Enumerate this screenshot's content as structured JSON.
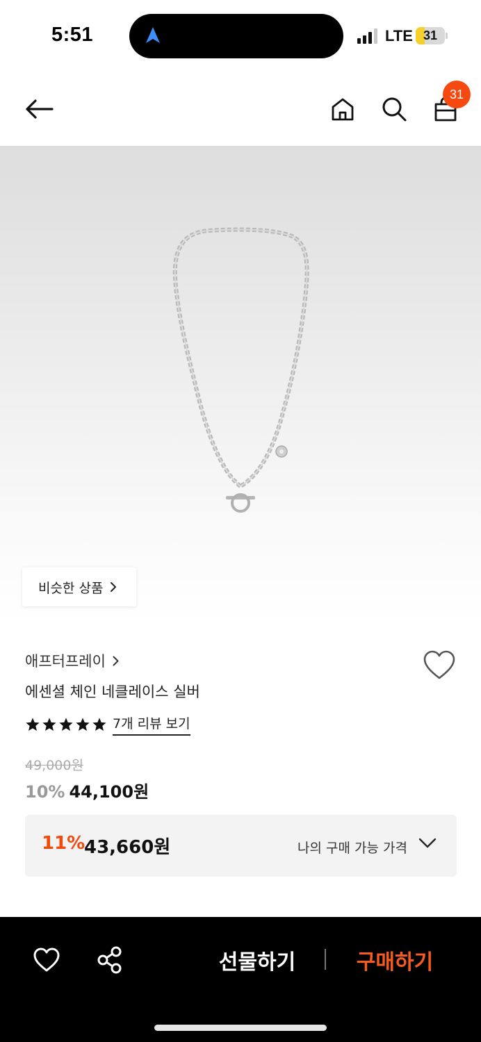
{
  "status_bar": {
    "time": "5:51",
    "network": "LTE",
    "battery_level": "31",
    "battery_fill_percent": 31,
    "navigation_icon": "navigation-arrow-icon"
  },
  "header": {
    "back_icon": "back-arrow-icon",
    "home_icon": "home-icon",
    "search_icon": "search-icon",
    "cart_icon": "shopping-bag-icon",
    "cart_badge": "31"
  },
  "product": {
    "image_alt": "silver chain necklace",
    "similar_products_label": "비슷한 상품",
    "brand": "애프터프레이",
    "name": "에센셜 체인 네클레이스 실버",
    "rating_stars": 5,
    "review_link": "7개 리뷰 보기",
    "original_price": "49,000원",
    "discount_rate": "10%",
    "sale_price": "44,100원"
  },
  "my_price": {
    "discount_rate": "11%",
    "price": "43,660원",
    "label": "나의 구매 가능 가격"
  },
  "bottom_bar": {
    "gift_label": "선물하기",
    "buy_label": "구매하기"
  },
  "colors": {
    "accent": "#f04a0c",
    "badge": "#f5490f",
    "battery": "#f5d02a",
    "nav_arrow": "#3d8ef7"
  }
}
